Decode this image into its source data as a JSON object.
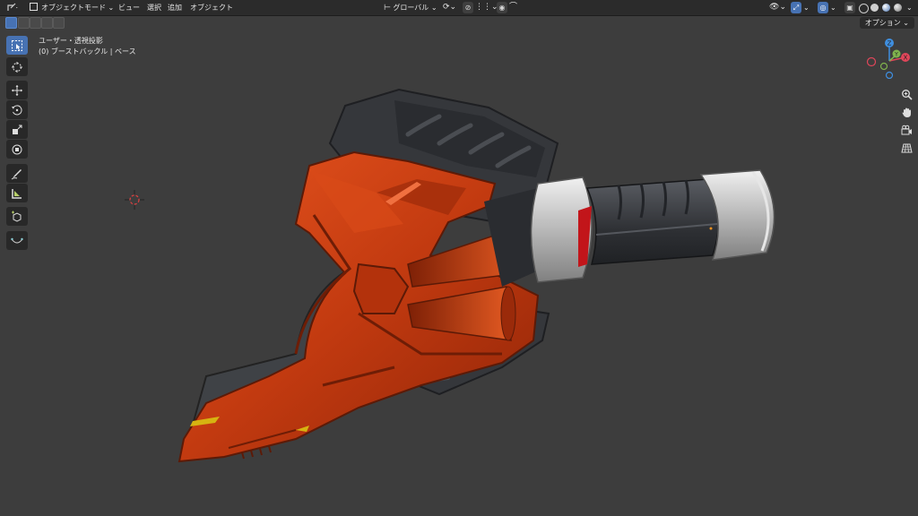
{
  "header": {
    "object_mode_label": "オブジェクトモード",
    "menus": [
      "ビュー",
      "選択",
      "追加",
      "オブジェクト"
    ],
    "transform_orientation": "グローバル"
  },
  "viewport": {
    "options_label": "オプション",
    "view_name": "ユーザー・透視投影",
    "object_info": "(0) ブーストバックル | ベース"
  },
  "gizmo": {
    "x": "X",
    "y": "Y",
    "z": "Z"
  },
  "icons": {
    "toolbar": [
      "select-box-icon",
      "cursor-icon",
      "move-icon",
      "rotate-icon",
      "scale-icon",
      "transform-icon",
      "annotate-icon",
      "measure-icon",
      "add-cube-icon",
      "curve-icon"
    ],
    "nav": [
      "zoom-icon",
      "pan-icon",
      "camera-icon",
      "grid-icon"
    ]
  },
  "colors": {
    "viewport_bg": "#3d3d3d",
    "accent": "#4772b3",
    "model_red": "#c43a12",
    "model_grey": "#3a3c40",
    "model_silver": "#c4c4c4",
    "axis_x": "#e0465a",
    "axis_y": "#7fb34d",
    "axis_z": "#3f8fe0"
  }
}
